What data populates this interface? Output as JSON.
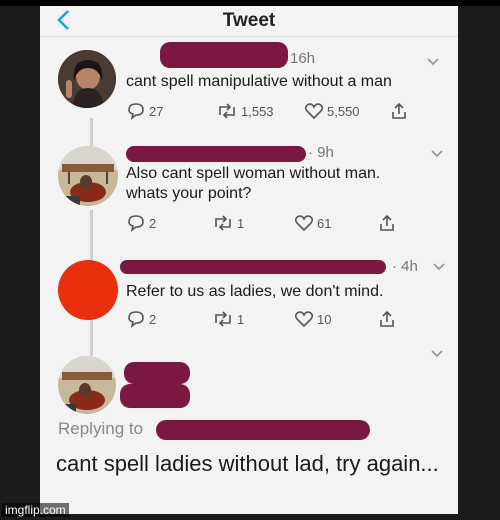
{
  "header": {
    "title": "Tweet"
  },
  "colors": {
    "redact": "#7a1841",
    "accent": "#1da1f2",
    "red_avatar": "#e8300e"
  },
  "tweets": [
    {
      "time": "16h",
      "text": "cant spell manipulative without a man",
      "replies": "27",
      "retweets": "1,553",
      "likes": "5,550"
    },
    {
      "time": "· 9h",
      "text": "Also cant spell woman without man. whats your point?",
      "replies": "2",
      "retweets": "1",
      "likes": "61"
    },
    {
      "time": "· 4h",
      "text": "Refer to us as ladies, we don't mind.",
      "replies": "2",
      "retweets": "1",
      "likes": "10"
    }
  ],
  "main": {
    "replying_to": "Replying to",
    "text": "cant spell ladies without lad, try again..."
  },
  "watermark": "imgflip.com"
}
